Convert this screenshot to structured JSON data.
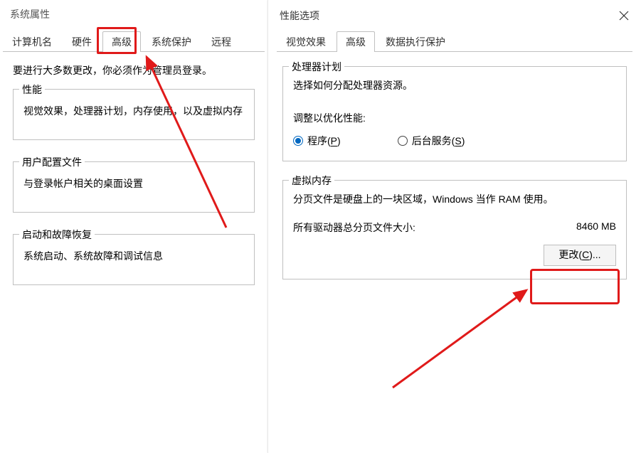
{
  "sysprops": {
    "title": "系统属性",
    "tabs": [
      "计算机名",
      "硬件",
      "高级",
      "系统保护",
      "远程"
    ],
    "selected_tab_index": 2,
    "admin_note": "要进行大多数更改，你必须作为管理员登录。",
    "sections": {
      "performance": {
        "legend": "性能",
        "desc": "视觉效果，处理器计划，内存使用，以及虚拟内存"
      },
      "user_profiles": {
        "legend": "用户配置文件",
        "desc": "与登录帐户相关的桌面设置"
      },
      "startup_recovery": {
        "legend": "启动和故障恢复",
        "desc": "系统启动、系统故障和调试信息"
      }
    }
  },
  "perfopts": {
    "title": "性能选项",
    "tabs": [
      "视觉效果",
      "高级",
      "数据执行保护"
    ],
    "selected_tab_index": 1,
    "processor": {
      "legend": "处理器计划",
      "desc": "选择如何分配处理器资源。",
      "adjust_label": "调整以优化性能:",
      "radio_programs_prefix": "程序(",
      "radio_programs_key": "P",
      "radio_programs_suffix": ")",
      "radio_services_prefix": "后台服务(",
      "radio_services_key": "S",
      "radio_services_suffix": ")",
      "selected": "programs"
    },
    "vm": {
      "legend": "虚拟内存",
      "desc": "分页文件是硬盘上的一块区域，Windows 当作 RAM 使用。",
      "total_label": "所有驱动器总分页文件大小:",
      "total_value": "8460 MB",
      "change_label_prefix": "更改(",
      "change_label_key": "C",
      "change_label_suffix": ")..."
    }
  }
}
